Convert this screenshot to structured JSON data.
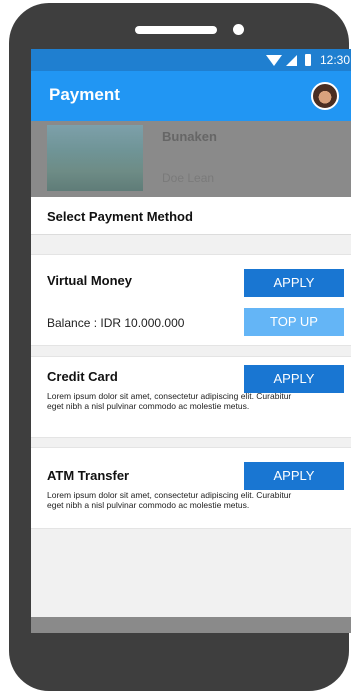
{
  "status_bar": {
    "time": "12:30"
  },
  "app_bar": {
    "title": "Payment"
  },
  "background_card": {
    "destination": "Bunaken",
    "user": "Doe Lean"
  },
  "sheet": {
    "title": "Select Payment Method",
    "methods": [
      {
        "name": "Virtual Money",
        "apply_label": "APPLY",
        "balance": "Balance : IDR 10.000.000",
        "topup_label": "TOP UP"
      },
      {
        "name": "Credit Card",
        "apply_label": "APPLY",
        "description": "Lorem ipsum dolor sit amet, consectetur adipiscing elit. Curabitur eget nibh a nisl pulvinar commodo ac molestie metus."
      },
      {
        "name": "ATM Transfer",
        "apply_label": "APPLY",
        "description": "Lorem ipsum dolor sit amet, consectetur adipiscing elit. Curabitur eget nibh a nisl pulvinar commodo ac molestie metus."
      }
    ]
  },
  "colors": {
    "primary": "#2196f3",
    "status_bar": "#1f7fd0",
    "apply_button": "#1976d2",
    "topup_button": "#64b5f6"
  }
}
